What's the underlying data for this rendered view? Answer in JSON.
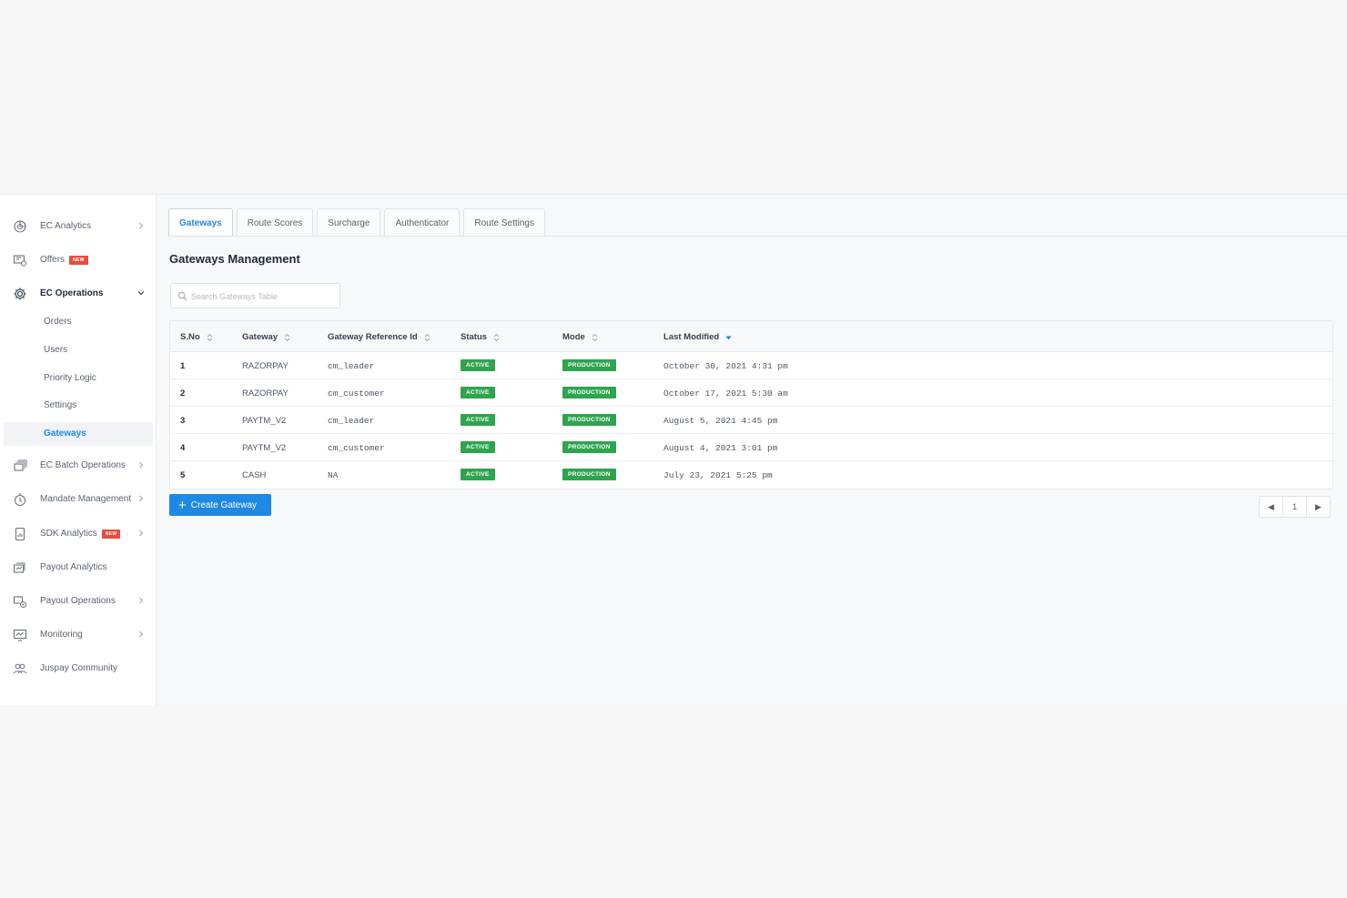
{
  "sidebar": {
    "items": [
      {
        "label": "EC Analytics",
        "icon": "chart-icon",
        "chevron": "right"
      },
      {
        "label": "Offers",
        "icon": "offers-icon",
        "badge": "NEW"
      },
      {
        "label": "EC Operations",
        "icon": "gear-icon",
        "chevron": "down"
      },
      {
        "label": "EC Batch Operations",
        "icon": "batch-icon",
        "chevron": "right"
      },
      {
        "label": "Mandate Management",
        "icon": "mandate-icon",
        "chevron": "right"
      },
      {
        "label": "SDK Analytics",
        "icon": "sdk-icon",
        "badge": "NEW",
        "chevron": "right"
      },
      {
        "label": "Payout Analytics",
        "icon": "payout-analytics-icon"
      },
      {
        "label": "Payout Operations",
        "icon": "payout-operations-icon",
        "chevron": "right"
      },
      {
        "label": "Monitoring",
        "icon": "monitoring-icon",
        "chevron": "right"
      },
      {
        "label": "Juspay Community",
        "icon": "community-icon"
      }
    ],
    "sub_items": [
      "Orders",
      "Users",
      "Priority Logic",
      "Settings",
      "Gateways"
    ],
    "active_sub_item": "Gateways"
  },
  "tabs": [
    "Gateways",
    "Route Scores",
    "Surcharge",
    "Authenticator",
    "Route Settings"
  ],
  "active_tab": "Gateways",
  "page_title": "Gateways Management",
  "search": {
    "placeholder": "Search Gateways Table",
    "value": ""
  },
  "table": {
    "headers": [
      "S.No",
      "Gateway",
      "Gateway Reference Id",
      "Status",
      "Mode",
      "Last Modified"
    ],
    "sorted_column": "Last Modified",
    "rows": [
      {
        "sno": "1",
        "gateway": "RAZORPAY",
        "ref": "cm_leader",
        "status": "ACTIVE",
        "mode": "PRODUCTION",
        "modified": "October 30, 2021 4:31 pm"
      },
      {
        "sno": "2",
        "gateway": "RAZORPAY",
        "ref": "cm_customer",
        "status": "ACTIVE",
        "mode": "PRODUCTION",
        "modified": "October 17, 2021 5:30 am"
      },
      {
        "sno": "3",
        "gateway": "PAYTM_V2",
        "ref": "cm_leader",
        "status": "ACTIVE",
        "mode": "PRODUCTION",
        "modified": "August 5, 2021 4:45 pm"
      },
      {
        "sno": "4",
        "gateway": "PAYTM_V2",
        "ref": "cm_customer",
        "status": "ACTIVE",
        "mode": "PRODUCTION",
        "modified": "August 4, 2021 3:01 pm"
      },
      {
        "sno": "5",
        "gateway": "CASH",
        "ref": "NA",
        "status": "ACTIVE",
        "mode": "PRODUCTION",
        "modified": "July 23, 2021 5:25 pm"
      }
    ]
  },
  "create_button": {
    "label": "Create Gateway"
  },
  "pagination": {
    "current_page": "1",
    "prev": "◀",
    "next": "▶"
  },
  "colors": {
    "accent": "#1e88e5",
    "status_green": "#2ea44f",
    "badge_red": "#e74c3c"
  }
}
